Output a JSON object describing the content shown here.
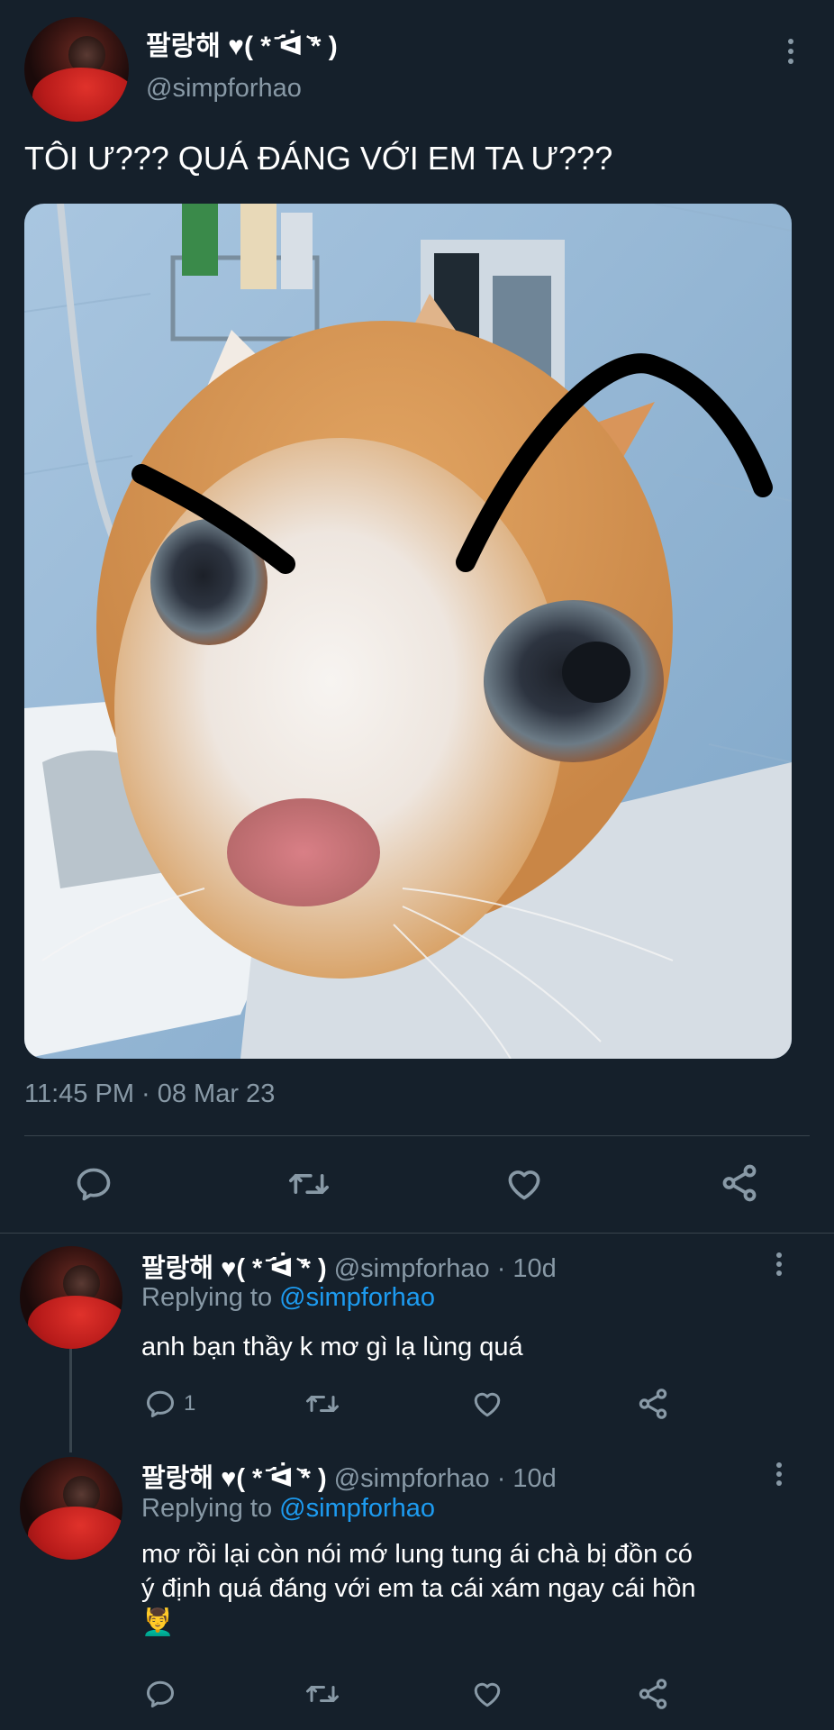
{
  "tweet": {
    "display_name": "팔랑해 ♥( * ᷄ᐛ ᷅* )",
    "handle": "@simpforhao",
    "text": "TÔI Ư??? QUÁ ĐÁNG VỚI EM TA Ư???",
    "timestamp": "11:45 PM · 08 Mar 23",
    "actions": [
      "reply-icon",
      "retweet-icon",
      "like-icon",
      "share-icon"
    ]
  },
  "replies": [
    {
      "display_name": "팔랑해 ♥( * ᷄ᐛ ᷅* )",
      "handle": "@simpforhao",
      "time": "· 10d",
      "replying_prefix": "Replying to",
      "replying_handle": "@simpforhao",
      "text_lines": [
        "anh bạn thầy k mơ gì lạ lùng quá"
      ],
      "reply_count": "1"
    },
    {
      "display_name": "팔랑해 ♥( * ᷄ᐛ ᷅* )",
      "handle": "@simpforhao",
      "time": "· 10d",
      "replying_prefix": "Replying to",
      "replying_handle": "@simpforhao",
      "text_lines": [
        "mơ rồi lại còn nói mớ lung tung ái chà bị đồn có",
        "ý định quá đáng với em ta cái xám ngay cái hồn",
        "💆‍♂️"
      ],
      "reply_count": ""
    }
  ],
  "colors": {
    "background": "#15202b",
    "muted": "#8899a6",
    "link": "#1d9bf0",
    "divider": "#38444d"
  }
}
